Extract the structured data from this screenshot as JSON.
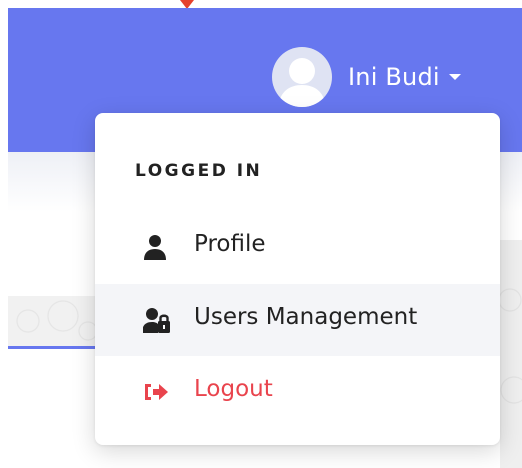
{
  "navbar": {
    "background": "#6777ef"
  },
  "user": {
    "name": "Ini Budi",
    "avatar_icon": "user-avatar-icon"
  },
  "dropdown": {
    "title": "LOGGED IN",
    "items": [
      {
        "label": "Profile",
        "icon": "user-icon",
        "active": false,
        "danger": false
      },
      {
        "label": "Users Management",
        "icon": "user-lock-icon",
        "active": true,
        "danger": false
      },
      {
        "label": "Logout",
        "icon": "sign-out-icon",
        "active": false,
        "danger": true
      }
    ]
  },
  "colors": {
    "accent": "#6777ef",
    "danger": "#e9444d",
    "text": "#222222"
  }
}
